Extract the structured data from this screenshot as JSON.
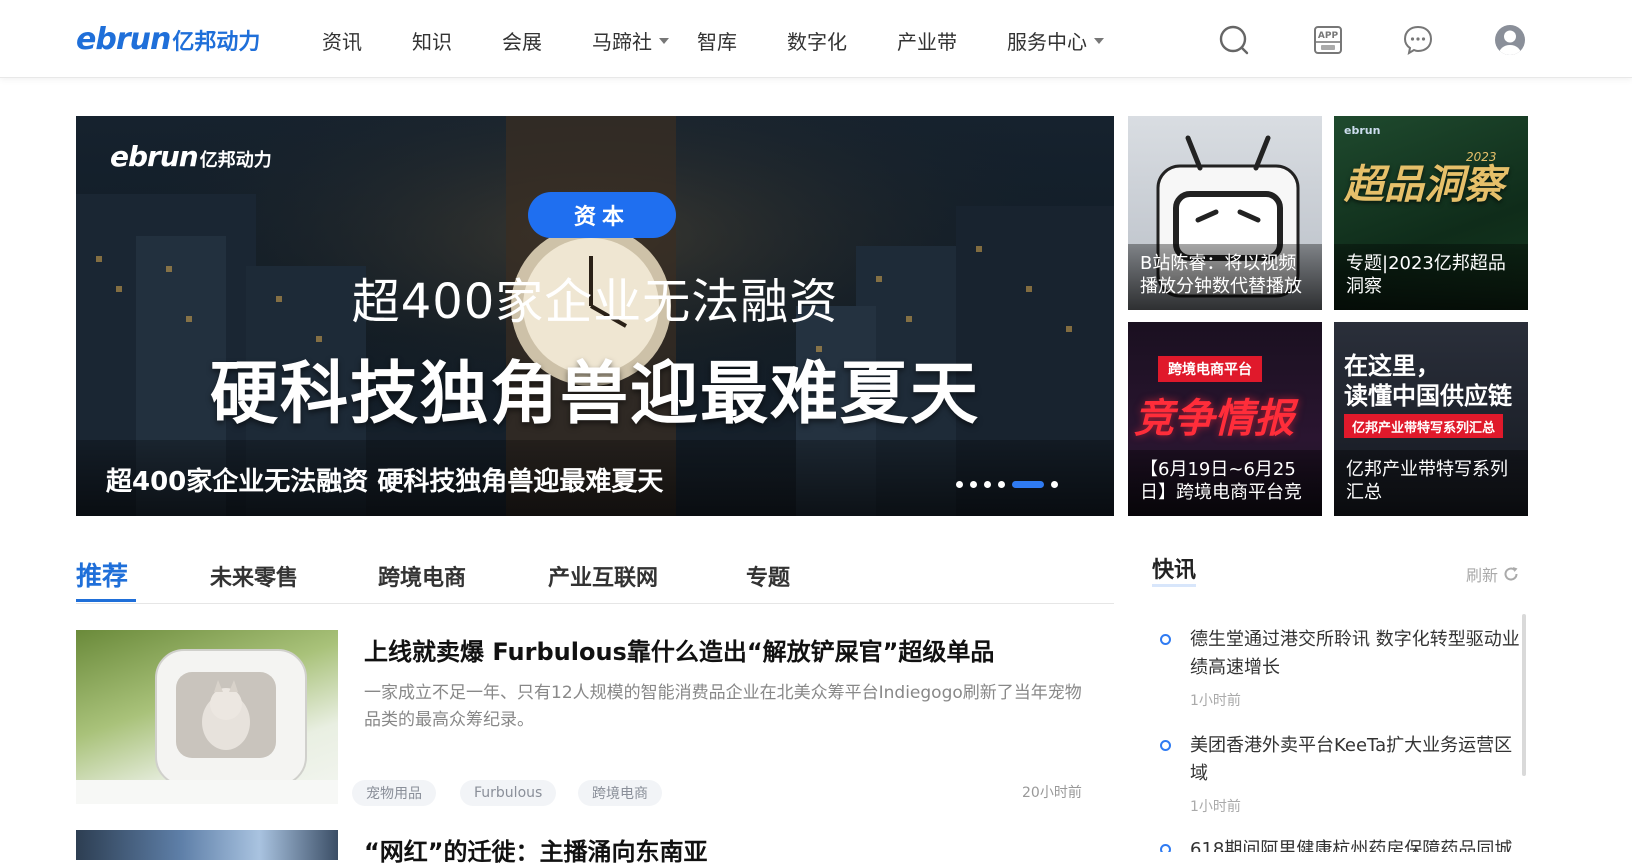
{
  "header": {
    "logo_en": "ebrun",
    "logo_cn": "亿邦动力",
    "nav": [
      {
        "label": "资讯",
        "dropdown": false
      },
      {
        "label": "知识",
        "dropdown": false
      },
      {
        "label": "会展",
        "dropdown": false
      },
      {
        "label": "马蹄社",
        "dropdown": true
      },
      {
        "label": "智库",
        "dropdown": false
      },
      {
        "label": "数字化",
        "dropdown": false
      },
      {
        "label": "产业带",
        "dropdown": false
      },
      {
        "label": "服务中心",
        "dropdown": true
      }
    ],
    "icons": [
      "search-icon",
      "app-icon",
      "message-icon",
      "user-icon"
    ],
    "app_icon_text": "APP"
  },
  "banner": {
    "logo_en": "ebrun",
    "logo_cn": "亿邦动力",
    "tag": "资本",
    "headline1": "超400家企业无法融资",
    "headline2": "硬科技独角兽迎最难夏天",
    "caption": "超400家企业无法融资 硬科技独角兽迎最难夏天",
    "slide_count": 6,
    "active_slide": 5
  },
  "tiles": [
    {
      "caption": "B站陈睿：将以视频播放分钟数代替播放"
    },
    {
      "caption": "专题|2023亿邦超品洞察",
      "art_text": "超品洞察",
      "art_small": "2023"
    },
    {
      "caption": "【6月19日~6月25日】跨境电商平台竞",
      "art_badge": "跨境电商平台",
      "art_text": "竞争情报"
    },
    {
      "caption": "亿邦产业带特写系列汇总",
      "art_line1": "在这里，",
      "art_line2": "读懂中国供应链",
      "art_badge": "亿邦产业带特写系列汇总"
    }
  ],
  "tabs": [
    "推荐",
    "未来零售",
    "跨境电商",
    "产业互联网",
    "专题"
  ],
  "articles": [
    {
      "title": "上线就卖爆 Furbulous靠什么造出“解放铲屎官”超级单品",
      "desc": "一家成立不足一年、只有12人规模的智能消费品企业在北美众筹平台Indiegogo刷新了当年宠物品类的最高众筹纪录。",
      "tags": [
        "宠物用品",
        "Furbulous",
        "跨境电商"
      ],
      "time": "20小时前"
    },
    {
      "title": "“网红”的迁徙：主播涌向东南亚"
    }
  ],
  "flash": {
    "title": "快讯",
    "refresh": "刷新",
    "items": [
      {
        "text": "德生堂通过港交所聆讯 数字化转型驱动业绩高速增长",
        "time": "1小时前"
      },
      {
        "text": "美团香港外卖平台KeeTa扩大业务运营区域",
        "time": "1小时前"
      },
      {
        "text": "618期间阿里健康杭州药房保障药品同城"
      }
    ]
  },
  "colors": {
    "accent": "#1f6fd9",
    "active_dot": "#2f7bf2",
    "tag_pill": "#1f6ff0"
  }
}
